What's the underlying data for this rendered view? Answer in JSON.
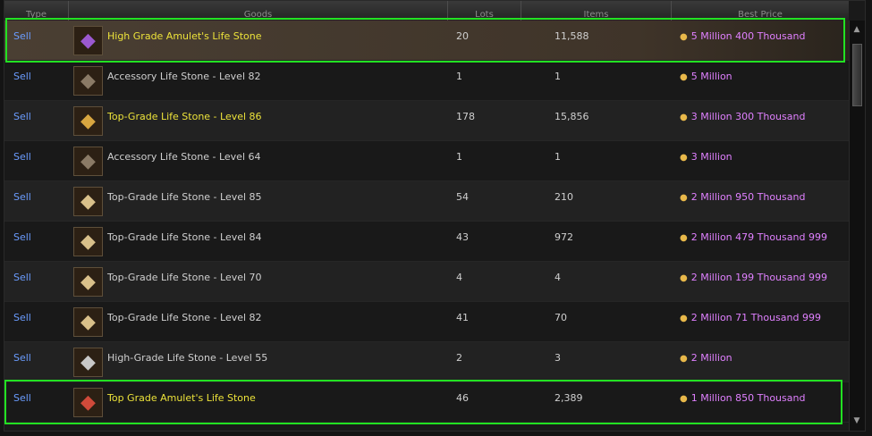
{
  "columns": {
    "type": "Type",
    "goods": "Goods",
    "lots": "Lots",
    "items": "Items",
    "best_price": "Best Price"
  },
  "rows": [
    {
      "type": "Sell",
      "name": "High Grade Amulet's Life Stone",
      "lots": "20",
      "items": "11,588",
      "price": "5 Million 400 Thousand",
      "icon": "amulet-life-stone-purple-icon",
      "icon_color": "#9b59d0"
    },
    {
      "type": "Sell",
      "name": "Accessory Life Stone - Level 82",
      "lots": "1",
      "items": "1",
      "price": "5 Million",
      "icon": "accessory-life-stone-icon",
      "icon_color": "#8a7a66"
    },
    {
      "type": "Sell",
      "name": "Top-Grade Life Stone - Level 86",
      "lots": "178",
      "items": "15,856",
      "price": "3 Million 300 Thousand",
      "icon": "top-grade-life-stone-gold-icon",
      "icon_color": "#d8a640"
    },
    {
      "type": "Sell",
      "name": "Accessory Life Stone - Level 64",
      "lots": "1",
      "items": "1",
      "price": "3 Million",
      "icon": "accessory-life-stone-icon",
      "icon_color": "#8a7a66"
    },
    {
      "type": "Sell",
      "name": "Top-Grade Life Stone - Level 85",
      "lots": "54",
      "items": "210",
      "price": "2 Million 950 Thousand",
      "icon": "top-grade-life-stone-icon",
      "icon_color": "#d9c08a"
    },
    {
      "type": "Sell",
      "name": "Top-Grade Life Stone - Level 84",
      "lots": "43",
      "items": "972",
      "price": "2 Million 479 Thousand 999",
      "icon": "top-grade-life-stone-icon",
      "icon_color": "#d9c08a"
    },
    {
      "type": "Sell",
      "name": "Top-Grade Life Stone - Level 70",
      "lots": "4",
      "items": "4",
      "price": "2 Million 199 Thousand 999",
      "icon": "top-grade-life-stone-icon",
      "icon_color": "#d9c08a"
    },
    {
      "type": "Sell",
      "name": "Top-Grade Life Stone - Level 82",
      "lots": "41",
      "items": "70",
      "price": "2 Million 71 Thousand 999",
      "icon": "top-grade-life-stone-icon",
      "icon_color": "#d9c08a"
    },
    {
      "type": "Sell",
      "name": "High-Grade Life Stone - Level 55",
      "lots": "2",
      "items": "3",
      "price": "2 Million",
      "icon": "high-grade-life-stone-icon",
      "icon_color": "#c8c8c8"
    },
    {
      "type": "Sell",
      "name": "Top Grade Amulet's Life Stone",
      "lots": "46",
      "items": "2,389",
      "price": "1 Million 850 Thousand",
      "icon": "amulet-life-stone-red-icon",
      "icon_color": "#d04a3a"
    }
  ],
  "currency_icon": "adena-coins-icon",
  "scroll": {
    "up_icon": "scroll-up-arrow-icon",
    "down_icon": "scroll-down-arrow-icon"
  }
}
